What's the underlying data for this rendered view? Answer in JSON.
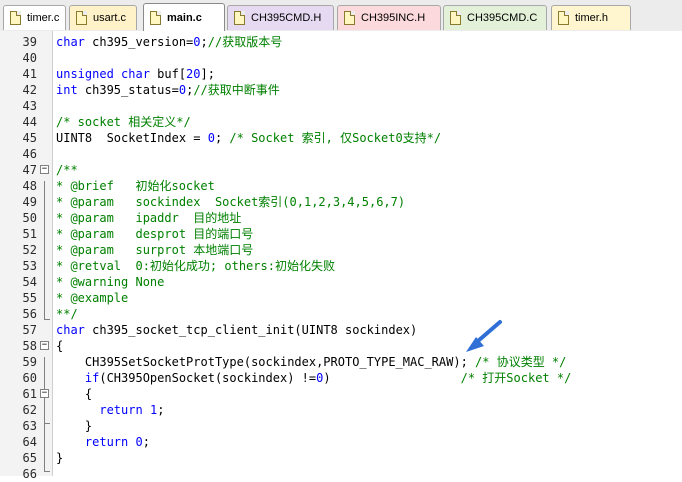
{
  "tabs": [
    {
      "label": "timer.c",
      "color": "#ffffff"
    },
    {
      "label": "usart.c",
      "color": "#fff2c8"
    },
    {
      "label": "main.c",
      "color": "#ffffff",
      "active": true
    },
    {
      "label": "CH395CMD.H",
      "color": "#e6daf2"
    },
    {
      "label": "CH395INC.H",
      "color": "#fbd9dc"
    },
    {
      "label": "CH395CMD.C",
      "color": "#e3f1d8"
    },
    {
      "label": "timer.h",
      "color": "#fff6cf"
    }
  ],
  "code_lines": [
    {
      "n": "39",
      "segs": [
        [
          "kw",
          "char"
        ],
        [
          "t",
          " ch395_version="
        ],
        [
          "num",
          "0"
        ],
        [
          "t",
          ";"
        ],
        [
          "cm",
          "//获取版本号"
        ]
      ]
    },
    {
      "n": "40",
      "segs": []
    },
    {
      "n": "41",
      "segs": [
        [
          "kw",
          "unsigned char"
        ],
        [
          "t",
          " buf["
        ],
        [
          "num",
          "20"
        ],
        [
          "t",
          "];"
        ]
      ]
    },
    {
      "n": "42",
      "segs": [
        [
          "kw",
          "int"
        ],
        [
          "t",
          " ch395_status="
        ],
        [
          "num",
          "0"
        ],
        [
          "t",
          ";"
        ],
        [
          "cm",
          "//获取中断事件"
        ]
      ]
    },
    {
      "n": "43",
      "segs": []
    },
    {
      "n": "44",
      "segs": [
        [
          "cm",
          "/* socket 相关定义*/"
        ]
      ]
    },
    {
      "n": "45",
      "segs": [
        [
          "t",
          "UINT8  SocketIndex = "
        ],
        [
          "num",
          "0"
        ],
        [
          "t",
          "; "
        ],
        [
          "cm",
          "/* Socket 索引, 仅Socket0支持*/"
        ]
      ]
    },
    {
      "n": "46",
      "segs": []
    },
    {
      "n": "47",
      "segs": [
        [
          "cm",
          "/**"
        ]
      ]
    },
    {
      "n": "48",
      "segs": [
        [
          "cm",
          "* @brief   初始化socket"
        ]
      ]
    },
    {
      "n": "49",
      "segs": [
        [
          "cm",
          "* @param   sockindex  Socket索引(0,1,2,3,4,5,6,7)"
        ]
      ]
    },
    {
      "n": "50",
      "segs": [
        [
          "cm",
          "* @param   ipaddr  目的地址"
        ]
      ]
    },
    {
      "n": "51",
      "segs": [
        [
          "cm",
          "* @param   desprot 目的端口号"
        ]
      ]
    },
    {
      "n": "52",
      "segs": [
        [
          "cm",
          "* @param   surprot 本地端口号"
        ]
      ]
    },
    {
      "n": "53",
      "segs": [
        [
          "cm",
          "* @retval  0:初始化成功; others:初始化失败"
        ]
      ]
    },
    {
      "n": "54",
      "segs": [
        [
          "cm",
          "* @warning None"
        ]
      ]
    },
    {
      "n": "55",
      "segs": [
        [
          "cm",
          "* @example"
        ]
      ]
    },
    {
      "n": "56",
      "segs": [
        [
          "cm",
          "**/"
        ]
      ]
    },
    {
      "n": "57",
      "segs": [
        [
          "kw",
          "char"
        ],
        [
          "t",
          " ch395_socket_tcp_client_init(UINT8 sockindex)"
        ]
      ]
    },
    {
      "n": "58",
      "segs": [
        [
          "t",
          "{"
        ]
      ]
    },
    {
      "n": "59",
      "segs": [
        [
          "t",
          "    CH395SetSocketProtType(sockindex,PROTO_TYPE_MAC_RAW); "
        ],
        [
          "cm",
          "/* 协议类型 */"
        ]
      ]
    },
    {
      "n": "60",
      "segs": [
        [
          "t",
          "    "
        ],
        [
          "kw",
          "if"
        ],
        [
          "t",
          "(CH395OpenSocket(sockindex) !="
        ],
        [
          "num",
          "0"
        ],
        [
          "t",
          ")                  "
        ],
        [
          "cm",
          "/* 打开Socket */"
        ]
      ]
    },
    {
      "n": "61",
      "segs": [
        [
          "t",
          "    {"
        ]
      ]
    },
    {
      "n": "62",
      "segs": [
        [
          "t",
          "      "
        ],
        [
          "kw",
          "return"
        ],
        [
          "t",
          " "
        ],
        [
          "num",
          "1"
        ],
        [
          "t",
          ";"
        ]
      ]
    },
    {
      "n": "63",
      "segs": [
        [
          "t",
          "    }"
        ]
      ]
    },
    {
      "n": "64",
      "segs": [
        [
          "t",
          "    "
        ],
        [
          "kw",
          "return"
        ],
        [
          "t",
          " "
        ],
        [
          "num",
          "0"
        ],
        [
          "t",
          ";"
        ]
      ]
    },
    {
      "n": "65",
      "segs": [
        [
          "t",
          "}"
        ]
      ]
    },
    {
      "n": "66",
      "segs": []
    }
  ],
  "colors": {
    "keyword": "#0000ff",
    "comment": "#008000",
    "arrow": "#2f6fd6"
  },
  "fold_markers": {
    "open": "−"
  }
}
